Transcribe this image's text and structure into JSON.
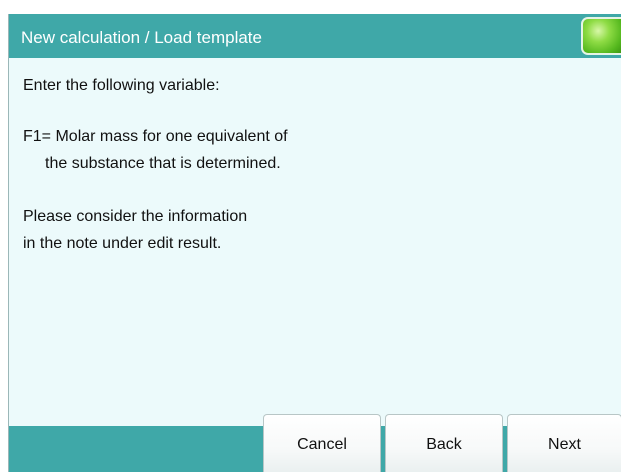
{
  "window": {
    "title": "New calculation / Load template"
  },
  "status": {
    "icon": "status-led-icon",
    "color": "#55b81e"
  },
  "content": {
    "lines": [
      "Enter the following variable:",
      "F1= Molar mass for one equivalent of",
      "the substance that is determined.",
      "Please consider the information",
      "in the note under edit result."
    ]
  },
  "buttons": {
    "cancel": "Cancel",
    "back": "Back",
    "next": "Next"
  },
  "colors": {
    "accent": "#3fa8a8",
    "background": "#ecfafb"
  }
}
